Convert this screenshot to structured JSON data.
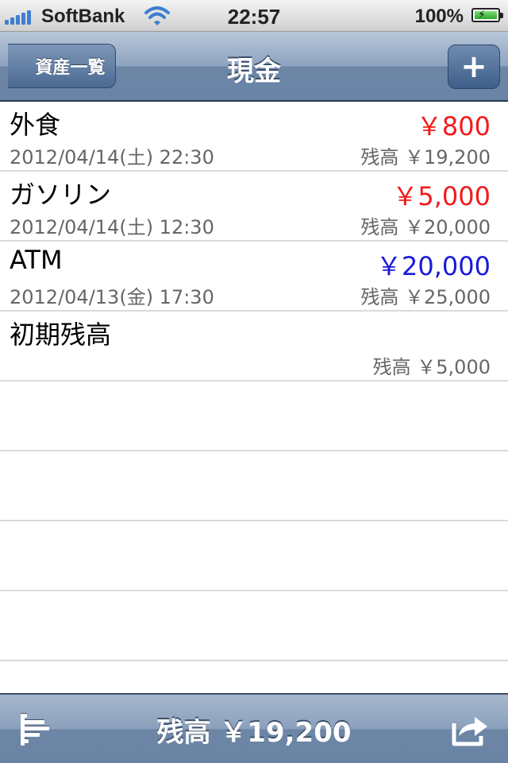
{
  "status_bar": {
    "carrier": "SoftBank",
    "time": "22:57",
    "battery": "100%"
  },
  "nav": {
    "back_label": "資産一覧",
    "title": "現金",
    "add_label": "+"
  },
  "transactions": [
    {
      "title": "外食",
      "amount": "￥800",
      "amount_color": "#f41a1a",
      "date": "2012/04/14(土) 22:30",
      "balance": "残高 ￥19,200"
    },
    {
      "title": "ガソリン",
      "amount": "￥5,000",
      "amount_color": "#f41a1a",
      "date": "2012/04/14(土) 12:30",
      "balance": "残高 ￥20,000"
    },
    {
      "title": "ATM",
      "amount": "￥20,000",
      "amount_color": "#1a1ad8",
      "date": "2012/04/13(金) 17:30",
      "balance": "残高 ￥25,000"
    },
    {
      "title": "初期残高",
      "amount": "",
      "amount_color": "#000000",
      "date": "",
      "balance": "残高 ￥5,000"
    }
  ],
  "toolbar": {
    "total": "残高 ￥19,200",
    "left_icon": "sort-icon",
    "right_icon": "share-icon"
  }
}
